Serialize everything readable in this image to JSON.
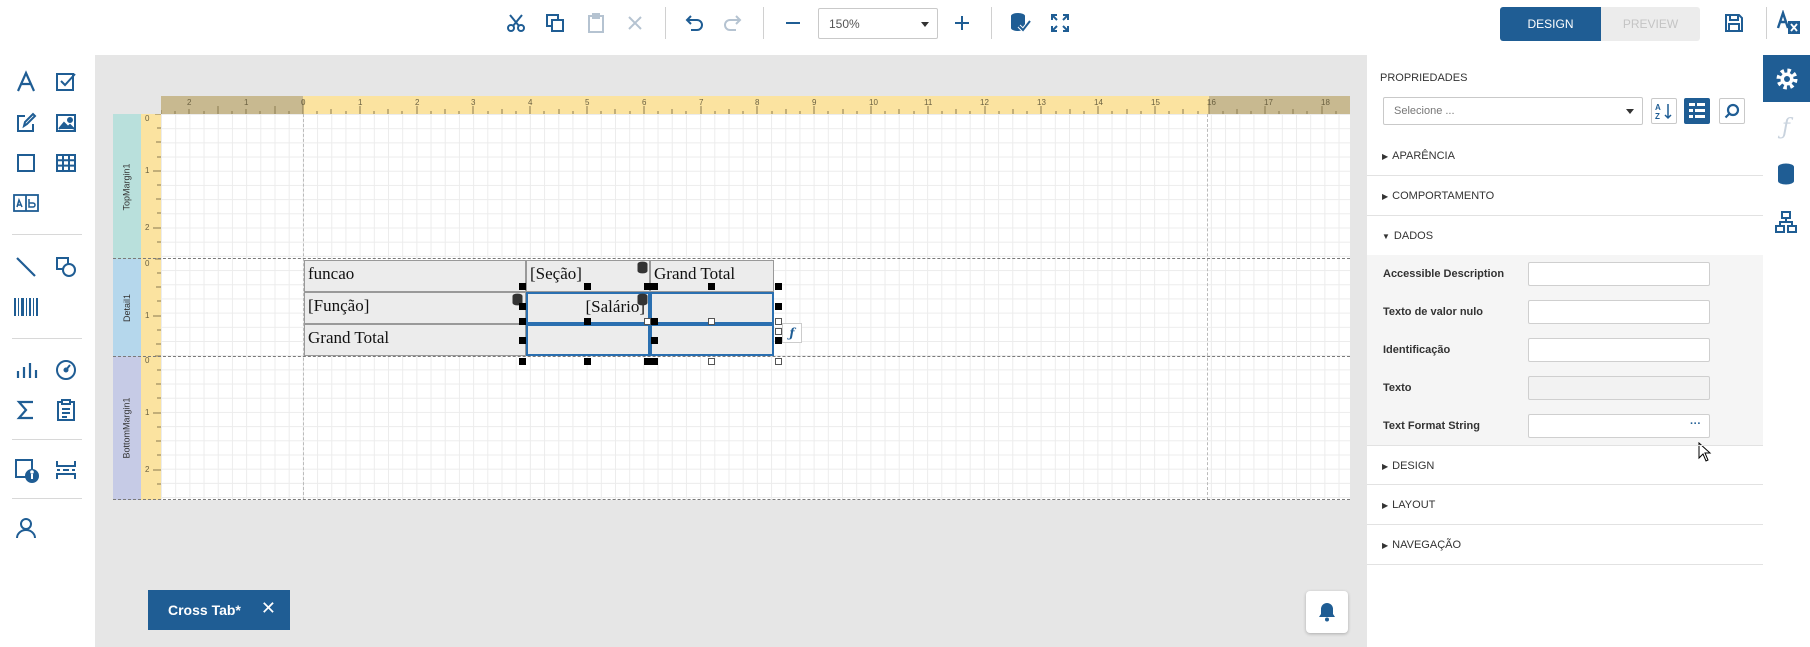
{
  "toolbar": {
    "zoom_value": "150%",
    "design_label": "DESIGN",
    "preview_label": "PREVIEW"
  },
  "toolbox": {
    "items": [
      "label",
      "checkbox",
      "rich-text",
      "picture-box",
      "panel",
      "table",
      "character-comb",
      "line",
      "shape",
      "barcode",
      "chart",
      "gauge",
      "summary",
      "page-info",
      "pivot-grid",
      "page-break",
      "user"
    ]
  },
  "ruler": {
    "top_ticks": [
      "2",
      "1",
      "0",
      "1",
      "2",
      "3",
      "4",
      "5",
      "6",
      "7",
      "8",
      "9",
      "10",
      "11",
      "12",
      "13",
      "14",
      "15",
      "16",
      "17",
      "18"
    ],
    "left_ticks_top": [
      "0",
      "1",
      "2"
    ],
    "left_ticks_detail": [
      "0",
      "1"
    ],
    "left_ticks_bottom": [
      "0",
      "1",
      "2"
    ]
  },
  "bands": {
    "top": "TopMargin1",
    "detail": "Detail1",
    "bottom": "BottomMargin1"
  },
  "crosstab": {
    "r1c1": "funcao",
    "r1c2": "[Seção]",
    "r1c3": "Grand Total",
    "r2c1": "[Função]",
    "r2c2": "[Salário]",
    "r2c3": "",
    "r3c1": "Grand Total",
    "r3c2": "",
    "r3c3": ""
  },
  "doc_tab": {
    "label": "Cross Tab*",
    "close": "✕"
  },
  "properties": {
    "title": "PROPRIEDADES",
    "select_placeholder": "Selecione ...",
    "sections": {
      "aparencia": "APARÊNCIA",
      "comportamento": "COMPORTAMENTO",
      "dados": "DADOS",
      "design": "DESIGN",
      "layout": "LAYOUT",
      "navegacao": "NAVEGAÇÃO"
    },
    "fields": {
      "accessible_description": "Accessible Description",
      "null_value_text": "Texto de valor nulo",
      "identification": "Identificação",
      "text": "Texto",
      "text_format_string": "Text Format String",
      "ellipsis": "···"
    }
  },
  "colors": {
    "accent": "#1f5d94",
    "ruler": "#fbe3a0",
    "top_margin_band": "#b9e0dc",
    "detail_band": "#b5d7ec",
    "bottom_margin_band": "#c6cbe6"
  }
}
